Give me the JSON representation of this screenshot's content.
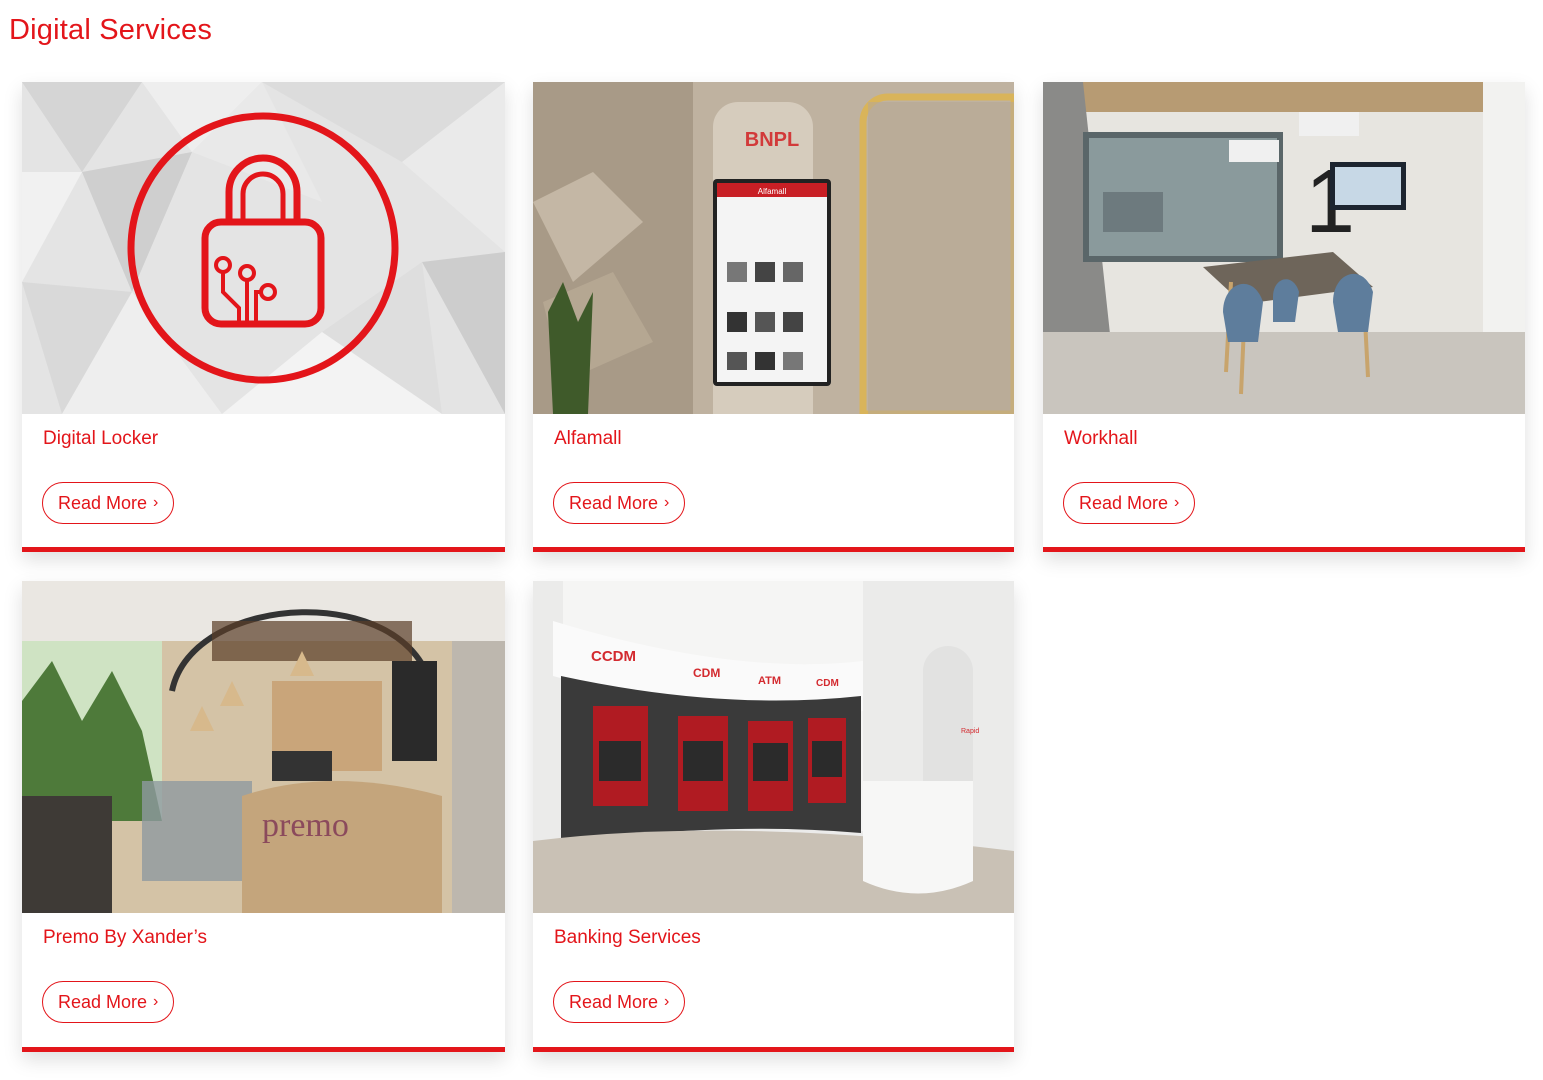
{
  "section": {
    "title": "Digital Services"
  },
  "cards": [
    {
      "title": "Digital Locker",
      "button": "Read More",
      "chevron": "›",
      "image": "digital-locker-image",
      "icon": "lock-circuit-icon"
    },
    {
      "title": "Alfamall",
      "button": "Read More",
      "chevron": "›",
      "image": "alfamall-kiosk-image",
      "sign": "BNPL",
      "screen_header": "Alfamall"
    },
    {
      "title": "Workhall",
      "button": "Read More",
      "chevron": "›",
      "image": "workhall-meeting-room-image",
      "sign": "1"
    },
    {
      "title": "Premo By Xander’s",
      "button": "Read More",
      "chevron": "›",
      "image": "premo-cafe-image",
      "sign": "premo"
    },
    {
      "title": "Banking Services",
      "button": "Read More",
      "chevron": "›",
      "image": "banking-atm-image",
      "signs": [
        "CCDM",
        "CDM",
        "ATM",
        "CDM"
      ],
      "side_sign": "Rapid"
    }
  ],
  "colors": {
    "accent": "#e3151a",
    "background": "#ffffff"
  }
}
